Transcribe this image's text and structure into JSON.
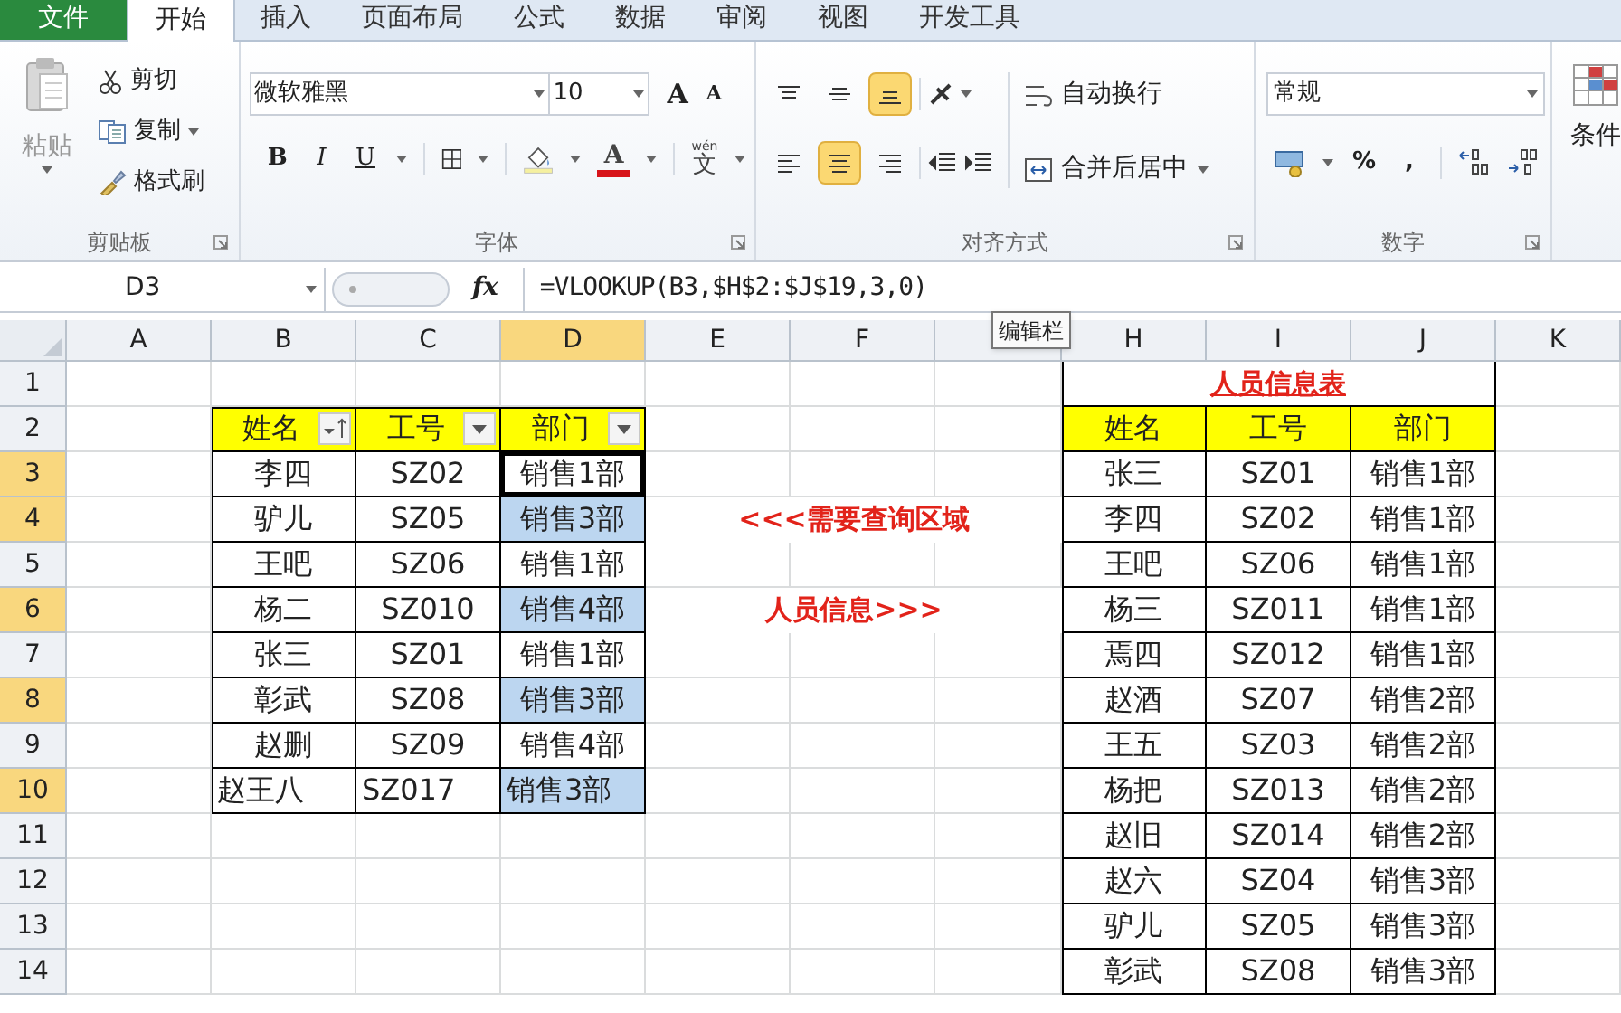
{
  "tabs": [
    {
      "label": "文件",
      "kind": "file",
      "selected": false
    },
    {
      "label": "开始",
      "kind": "tab",
      "selected": true
    },
    {
      "label": "插入",
      "kind": "tab",
      "selected": false
    },
    {
      "label": "页面布局",
      "kind": "tab",
      "selected": false
    },
    {
      "label": "公式",
      "kind": "tab",
      "selected": false
    },
    {
      "label": "数据",
      "kind": "tab",
      "selected": false
    },
    {
      "label": "审阅",
      "kind": "tab",
      "selected": false
    },
    {
      "label": "视图",
      "kind": "tab",
      "selected": false
    },
    {
      "label": "开发工具",
      "kind": "tab",
      "selected": false
    }
  ],
  "ribbon": {
    "clipboard": {
      "label": "剪贴板",
      "paste": "粘贴",
      "commands": [
        {
          "label": "剪切",
          "kind": "cut",
          "dropdown": false
        },
        {
          "label": "复制",
          "kind": "copy",
          "dropdown": true
        },
        {
          "label": "格式刷",
          "kind": "painter",
          "dropdown": false
        }
      ]
    },
    "font": {
      "label": "字体",
      "font_name": "微软雅黑",
      "font_size": "10",
      "size_buttons": [
        "A",
        "A"
      ],
      "style_buttons": [
        "B",
        "I",
        "U"
      ],
      "font_color_letter": "A",
      "phonetic": {
        "ruby": "wén",
        "glyph": "文"
      }
    },
    "alignment": {
      "label": "对齐方式",
      "vertical": [
        {
          "kind": "top",
          "selected": false
        },
        {
          "kind": "middle",
          "selected": false
        },
        {
          "kind": "bottom",
          "selected": true
        }
      ],
      "horizontal": [
        {
          "kind": "left",
          "selected": false
        },
        {
          "kind": "center",
          "selected": true
        },
        {
          "kind": "right",
          "selected": false
        }
      ],
      "wrap_text": "自动换行",
      "merge_center": "合并后居中"
    },
    "number": {
      "label": "数字",
      "format": "常规",
      "symbols": [
        "%",
        ","
      ]
    },
    "styles": {
      "conditional_formatting": "条件"
    }
  },
  "formula_bar": {
    "name_box": "D3",
    "function_button": "fx",
    "formula": "=VLOOKUP(B3,$H$2:$J$19,3,0)",
    "tooltip": "编辑栏"
  },
  "columns": [
    {
      "label": "A",
      "selected": false
    },
    {
      "label": "B",
      "selected": false
    },
    {
      "label": "C",
      "selected": false
    },
    {
      "label": "D",
      "selected": true
    },
    {
      "label": "E",
      "selected": false
    },
    {
      "label": "F",
      "selected": false
    },
    {
      "selected": false
    },
    {
      "label": "H",
      "selected": false
    },
    {
      "label": "I",
      "selected": false
    },
    {
      "label": "J",
      "selected": false
    },
    {
      "label": "K",
      "selected": false
    }
  ],
  "rows": [
    {
      "label": "1",
      "selected": false
    },
    {
      "label": "2",
      "selected": false
    },
    {
      "label": "3",
      "selected": true
    },
    {
      "label": "4",
      "selected": true
    },
    {
      "label": "5",
      "selected": false
    },
    {
      "label": "6",
      "selected": true
    },
    {
      "label": "7",
      "selected": false
    },
    {
      "label": "8",
      "selected": true
    },
    {
      "label": "9",
      "selected": false
    },
    {
      "label": "10",
      "selected": true
    },
    {
      "label": "11",
      "selected": false
    },
    {
      "label": "12",
      "selected": false
    },
    {
      "label": "13",
      "selected": false
    },
    {
      "label": "14",
      "selected": false
    }
  ],
  "lookup_table": {
    "headers": [
      {
        "label": "姓名",
        "kind": "sorted"
      },
      {
        "label": "工号",
        "kind": "dropdown"
      },
      {
        "label": "部门",
        "kind": "dropdown"
      }
    ],
    "rows": [
      {
        "cells": [
          "李四",
          "SZ02",
          "销售1部"
        ],
        "selected": false,
        "active": true,
        "left_aligned": false
      },
      {
        "cells": [
          "驴儿",
          "SZ05",
          "销售3部"
        ],
        "selected": true,
        "active": false,
        "left_aligned": false
      },
      {
        "cells": [
          "王吧",
          "SZ06",
          "销售1部"
        ],
        "selected": false,
        "active": false,
        "left_aligned": false
      },
      {
        "cells": [
          "杨二",
          "SZ010",
          "销售4部"
        ],
        "selected": true,
        "active": false,
        "left_aligned": false
      },
      {
        "cells": [
          "张三",
          "SZ01",
          "销售1部"
        ],
        "selected": false,
        "active": false,
        "left_aligned": false
      },
      {
        "cells": [
          "彰武",
          "SZ08",
          "销售3部"
        ],
        "selected": true,
        "active": false,
        "left_aligned": false
      },
      {
        "cells": [
          "赵删",
          "SZ09",
          "销售4部"
        ],
        "selected": false,
        "active": false,
        "left_aligned": false
      },
      {
        "cells": [
          "赵王八",
          "SZ017",
          "销售3部"
        ],
        "selected": true,
        "active": false,
        "left_aligned": true
      }
    ]
  },
  "notes": [
    "<<<需要查询区域",
    "人员信息>>>"
  ],
  "info_table": {
    "title": "人员信息表",
    "headers": [
      "姓名",
      "工号",
      "部门"
    ],
    "rows": [
      [
        "张三",
        "SZ01",
        "销售1部"
      ],
      [
        "李四",
        "SZ02",
        "销售1部"
      ],
      [
        "王吧",
        "SZ06",
        "销售1部"
      ],
      [
        "杨三",
        "SZ011",
        "销售1部"
      ],
      [
        "焉四",
        "SZ012",
        "销售1部"
      ],
      [
        "赵酒",
        "SZ07",
        "销售2部"
      ],
      [
        "王五",
        "SZ03",
        "销售2部"
      ],
      [
        "杨把",
        "SZ013",
        "销售2部"
      ],
      [
        "赵旧",
        "SZ014",
        "销售2部"
      ],
      [
        "赵六",
        "SZ04",
        "销售3部"
      ],
      [
        "驴儿",
        "SZ05",
        "销售3部"
      ],
      [
        "彰武",
        "SZ08",
        "销售3部"
      ]
    ]
  }
}
